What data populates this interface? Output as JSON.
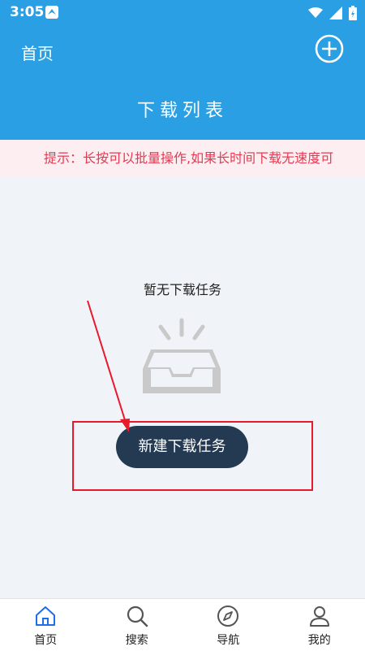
{
  "status_bar": {
    "time": "3:05"
  },
  "header": {
    "home_label": "首页",
    "title": "下载列表"
  },
  "notice": {
    "text": "提示：长按可以批量操作,如果长时间下载无速度可"
  },
  "empty_state": {
    "message": "暂无下载任务",
    "button_label": "新建下载任务"
  },
  "bottom_nav": {
    "items": [
      {
        "label": "首页",
        "icon": "home-icon"
      },
      {
        "label": "搜索",
        "icon": "search-icon"
      },
      {
        "label": "导航",
        "icon": "compass-icon"
      },
      {
        "label": "我的",
        "icon": "user-icon"
      }
    ]
  },
  "colors": {
    "primary": "#2b9fe4",
    "notice_text": "#e43a54",
    "button_bg": "#243a52",
    "highlight": "#e8192c"
  }
}
